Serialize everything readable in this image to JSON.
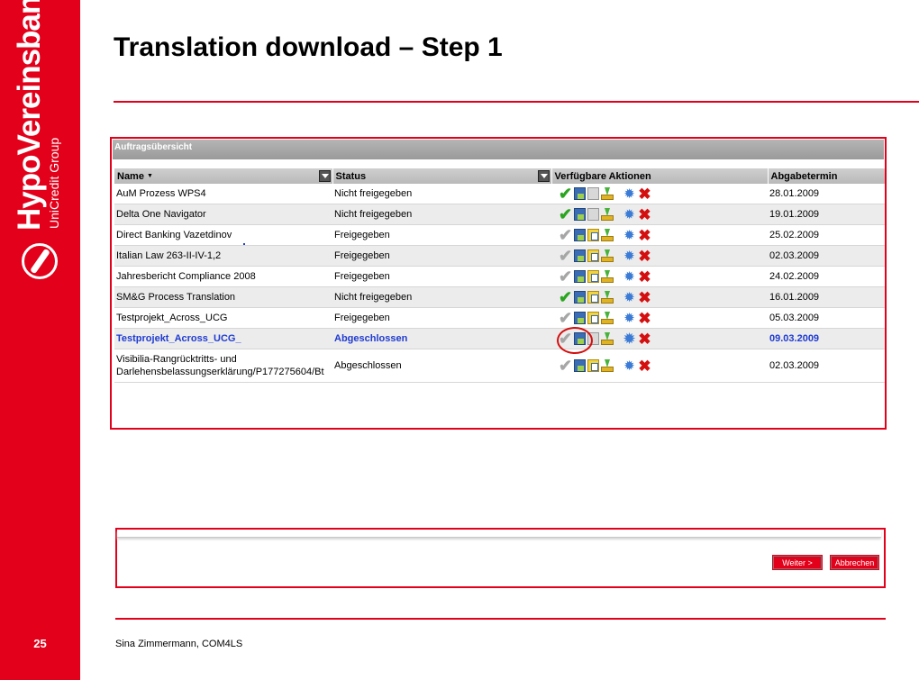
{
  "slide": {
    "title": "Translation download – Step 1",
    "page_number": "25",
    "footer": "Sina Zimmermann, COM4LS"
  },
  "brand": {
    "name": "HypoVereinsbank",
    "group": "UniCredit Group",
    "color": "#e2001a"
  },
  "screenshot": {
    "panel_title": "Auftragsübersicht",
    "columns": {
      "name": "Name",
      "status": "Status",
      "actions": "Verfügbare Aktionen",
      "due": "Abgabetermin"
    },
    "rows": [
      {
        "name": "AuM Prozess WPS4",
        "status": "Nicht freigegeben",
        "due": "28.01.2009"
      },
      {
        "name": "Delta One Navigator",
        "status": "Nicht freigegeben",
        "due": "19.01.2009"
      },
      {
        "name": "Direct Banking Vazetdinov",
        "status": "Freigegeben",
        "due": "25.02.2009"
      },
      {
        "name": "Italian Law 263-II-IV-1,2",
        "status": "Freigegeben",
        "due": "02.03.2009"
      },
      {
        "name": "Jahresbericht Compliance 2008",
        "status": "Freigegeben",
        "due": "24.02.2009"
      },
      {
        "name": "SM&G Process Translation",
        "status": "Nicht freigegeben",
        "due": "16.01.2009"
      },
      {
        "name": "Testprojekt_Across_UCG",
        "status": "Freigegeben",
        "due": "05.03.2009"
      },
      {
        "name": "Testprojekt_Across_UCG_",
        "status": "Abgeschlossen",
        "due": "09.03.2009"
      },
      {
        "name": "Visibilia-Rangrücktritts- und Darlehensbelassungserklärung/P177275604/Bt",
        "status": "Abgeschlossen",
        "due": "02.03.2009"
      }
    ]
  },
  "buttons": {
    "next": "Weiter >",
    "cancel": "Abbrechen"
  }
}
